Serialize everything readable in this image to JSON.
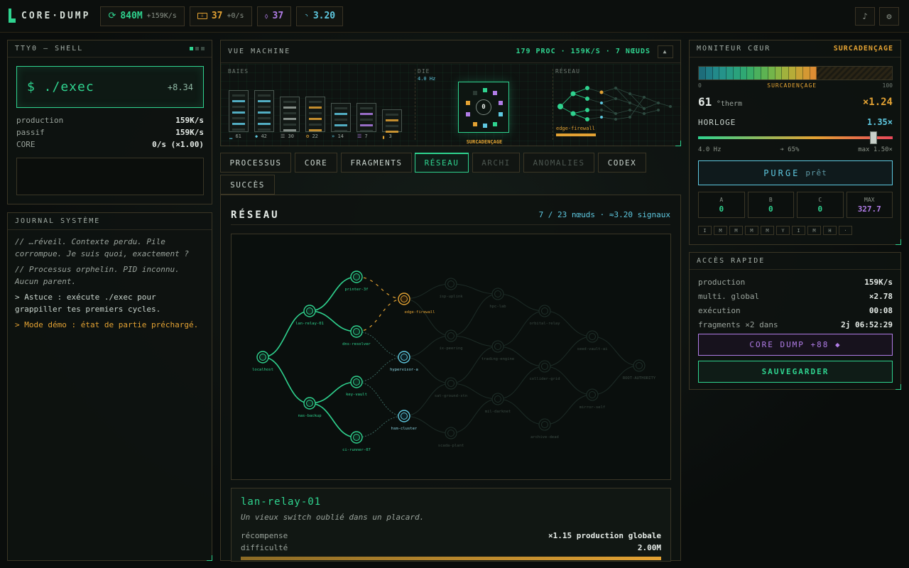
{
  "app": {
    "title": "CORE·DUMP"
  },
  "topbar": {
    "cycles": {
      "value": "840M",
      "rate": "+159K/s"
    },
    "ram": {
      "value": "37",
      "rate": "+0/s"
    },
    "fragments": {
      "value": "37"
    },
    "signal": {
      "value": "3.20"
    }
  },
  "shell": {
    "title": "TTY0 — SHELL",
    "exec_label": "$ ./exec",
    "exec_gain": "+8.34",
    "stats": [
      {
        "label": "production",
        "value": "159K/s"
      },
      {
        "label": "passif",
        "value": "159K/s"
      },
      {
        "label": "CORE",
        "value": "0/s (×1.00)"
      }
    ]
  },
  "journal": {
    "title": "JOURNAL SYSTÈME",
    "entries": [
      "// …réveil. Contexte perdu. Pile corrompue. Je suis quoi, exactement ?",
      "// Processus orphelin. PID inconnu. Aucun parent.",
      "> Astuce : exécute ./exec pour grappiller tes premiers cycles.",
      "> Mode démo : état de partie préchargé."
    ]
  },
  "machine": {
    "title": "VUE MACHINE",
    "summary": "179 PROC · 159K/S · 7 NŒUDS",
    "collapse_icon": "▲",
    "baies_label": "BAIES",
    "die_label": "DIE",
    "die_freq": "4.0 Hz",
    "die_state": "SURCADENÇAGE",
    "die_core": "0",
    "reseau_label": "RÉSEAU",
    "reseau_node": "edge-firewall",
    "racks": [
      "61",
      "42",
      "30",
      "22",
      "14",
      "7",
      "3"
    ]
  },
  "tabs": [
    {
      "label": "PROCESSUS",
      "state": "normal"
    },
    {
      "label": "CORE",
      "state": "normal"
    },
    {
      "label": "FRAGMENTS",
      "state": "normal"
    },
    {
      "label": "RÉSEAU",
      "state": "active"
    },
    {
      "label": "ARCHI",
      "state": "dim"
    },
    {
      "label": "ANOMALIES",
      "state": "dim"
    },
    {
      "label": "CODEX",
      "state": "normal"
    },
    {
      "label": "SUCCÈS",
      "state": "normal"
    }
  ],
  "network": {
    "title": "RÉSEAU",
    "summary": "7 / 23 nœuds · ≈3.20 signaux",
    "nodes": [
      {
        "id": "localhost",
        "state": "owned"
      },
      {
        "id": "lan-relay-01",
        "state": "owned"
      },
      {
        "id": "nas-backup",
        "state": "owned"
      },
      {
        "id": "printer-3f",
        "state": "owned"
      },
      {
        "id": "dns-resolver",
        "state": "owned"
      },
      {
        "id": "key-vault",
        "state": "owned"
      },
      {
        "id": "ci-runner-07",
        "state": "owned"
      },
      {
        "id": "edge-firewall",
        "state": "target"
      },
      {
        "id": "hypervisor-a",
        "state": "available"
      },
      {
        "id": "hsm-cluster",
        "state": "available"
      },
      {
        "id": "isp-uplink",
        "state": "locked"
      },
      {
        "id": "ix-peering",
        "state": "locked"
      },
      {
        "id": "sat-ground-stn",
        "state": "locked"
      },
      {
        "id": "scada-plant",
        "state": "locked"
      },
      {
        "id": "hpc-lab",
        "state": "locked"
      },
      {
        "id": "trading-engine",
        "state": "locked"
      },
      {
        "id": "mil-darknet",
        "state": "locked"
      },
      {
        "id": "orbital-relay",
        "state": "locked"
      },
      {
        "id": "collider-grid",
        "state": "locked"
      },
      {
        "id": "archive-dead",
        "state": "locked"
      },
      {
        "id": "seed-vault-ai",
        "state": "locked"
      },
      {
        "id": "mirror-self",
        "state": "locked"
      },
      {
        "id": "ROOT-AUTHORITY",
        "state": "locked"
      }
    ],
    "detail": {
      "name": "lan-relay-01",
      "description": "Un vieux switch oublié dans un placard.",
      "rows": [
        {
          "label": "récompense",
          "value": "×1.15 production globale"
        },
        {
          "label": "difficulté",
          "value": "2.00M"
        }
      ]
    }
  },
  "monitor": {
    "title": "MONITEUR CŒUR",
    "state": "SURCADENÇAGE",
    "heat_min": "0",
    "heat_state": "SURCADENÇAGE",
    "heat_max": "100",
    "heat_level": 0.61,
    "therm_value": "61",
    "therm_unit": "°therm",
    "multiplier": "×1.24",
    "clock_label": "HORLOGE",
    "clock_value": "1.35×",
    "clock_level": 0.9,
    "clock_min": "4.0 Hz",
    "clock_mid": "➔ 65%",
    "clock_max": "max 1.50×",
    "purge_label": "PURGE",
    "purge_state": "prêt",
    "cells": [
      {
        "label": "A",
        "value": "0"
      },
      {
        "label": "B",
        "value": "0"
      },
      {
        "label": "C",
        "value": "0"
      },
      {
        "label": "MAX",
        "value": "327.7"
      }
    ],
    "keys": [
      "I",
      "M",
      "M",
      "M",
      "M",
      "Y",
      "I",
      "M",
      "H",
      "·"
    ]
  },
  "quick": {
    "title": "ACCÈS RAPIDE",
    "rows": [
      {
        "label": "production",
        "value": "159K/s"
      },
      {
        "label": "multi. global",
        "value": "×2.78"
      },
      {
        "label": "exécution",
        "value": "00:08"
      },
      {
        "label": "fragments ×2 dans",
        "value": "2j 06:52:29"
      }
    ],
    "core_dump_label": "CORE DUMP +88 ◆",
    "save_label": "SAUVEGARDER"
  },
  "colors": {
    "accent": "#2fd38f",
    "amber": "#e3a233",
    "purple": "#b07ce6",
    "cyan": "#5ec8e0"
  }
}
